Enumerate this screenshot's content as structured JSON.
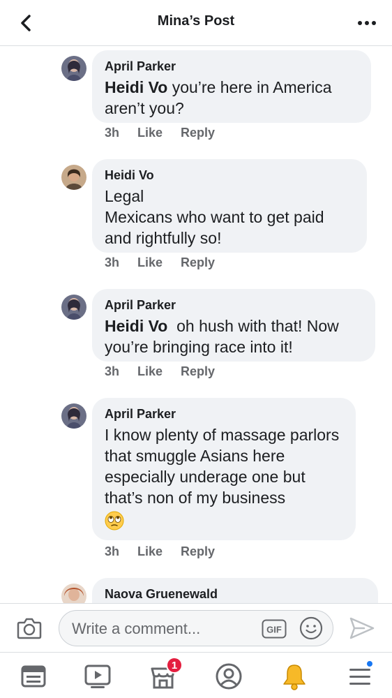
{
  "header": {
    "title": "Mina’s Post"
  },
  "comments": [
    {
      "author": "April Parker",
      "tag": "Heidi Vo",
      "text": " you’re here in America aren’t you?",
      "time": "3h",
      "like": "Like",
      "reply": "Reply"
    },
    {
      "author": "Heidi Vo",
      "text_lines": [
        "Legal",
        "Mexicans who want to get paid",
        "and rightfully so!"
      ],
      "time": "3h",
      "like": "Like",
      "reply": "Reply"
    },
    {
      "author": "April Parker",
      "tag": "Heidi Vo",
      "text": "  oh hush with that! Now you’re bringing race into it!",
      "time": "3h",
      "like": "Like",
      "reply": "Reply"
    },
    {
      "author": "April Parker",
      "text": "I know plenty of massage parlors that smuggle Asians here especially underage one but that’s non of my business",
      "emoji": "eye-roll-emoji",
      "time": "3h",
      "like": "Like",
      "reply": "Reply"
    },
    {
      "author": "Naova Gruenewald"
    }
  ],
  "composer": {
    "placeholder": "Write a comment..."
  },
  "bottom_nav": {
    "notifications_badge": "1",
    "accent": "#1877f2",
    "badge_color": "#e41e3f"
  }
}
